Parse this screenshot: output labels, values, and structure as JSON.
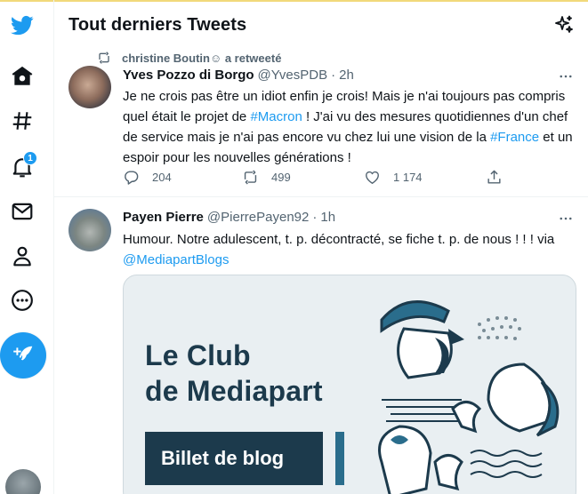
{
  "header": {
    "title": "Tout derniers Tweets"
  },
  "nav": {
    "items": [
      {
        "name": "twitter-logo"
      },
      {
        "name": "home"
      },
      {
        "name": "explore"
      },
      {
        "name": "notifications",
        "badge": "1"
      },
      {
        "name": "messages"
      },
      {
        "name": "profile"
      },
      {
        "name": "more"
      }
    ]
  },
  "tweets": [
    {
      "retweeted_by": "christine Boutin☺ a retweeté",
      "name": "Yves Pozzo di Borgo",
      "handle": "@YvesPDB",
      "separator": "·",
      "time": "2h",
      "text_parts": {
        "p1": "Je ne crois pas être un idiot enfin je crois! Mais je n'ai toujours pas compris quel était le projet de ",
        "tag1": "#Macron",
        "p2": " ! J'ai vu des mesures quotidiennes d'un chef de service mais je n'ai pas encore vu chez lui une vision de la ",
        "tag2": "#France",
        "p3": " et un espoir pour les nouvelles générations !"
      },
      "replies": "204",
      "retweets": "499",
      "likes": "1 174"
    },
    {
      "name": "Payen Pierre",
      "handle": "@PierrePayen92",
      "separator": "·",
      "time": "1h",
      "text_parts": {
        "p1": "Humour. Notre adulescent, t. p. décontracté, se fiche t. p. de nous ! ! ! via ",
        "mention": "@MediapartBlogs"
      },
      "card": {
        "title_line1": "Le Club",
        "title_line2": "de Mediapart",
        "button": "Billet de blog"
      }
    }
  ],
  "colors": {
    "accent": "#1d9bf0",
    "text": "#0f1419",
    "secondary": "#536471",
    "card_navy": "#1c3a4c"
  }
}
